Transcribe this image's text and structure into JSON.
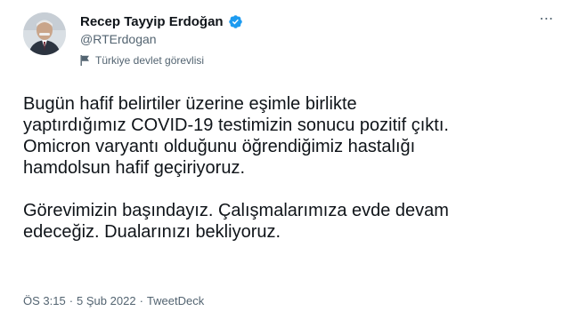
{
  "author": {
    "display_name": "Recep Tayyip Erdoğan",
    "handle": "@RTErdogan",
    "label": "Türkiye devlet görevlisi",
    "verified_color": "#1d9bf0"
  },
  "more_icon": "⋯",
  "tweet": {
    "paragraph1": [
      "Bugün hafif belirtiler üzerine eşimle birlikte",
      "yaptırdığımız COVID-19 testimizin sonucu pozitif çıktı.",
      "Omicron varyantı olduğunu öğrendiğimiz hastalığı",
      "hamdolsun hafif geçiriyoruz."
    ],
    "paragraph2": [
      "Görevimizin başındayız. Çalışmalarımıza evde devam",
      "edeceğiz. Dualarınızı bekliyoruz."
    ]
  },
  "meta": {
    "time": "ÖS 3:15",
    "sep1": "·",
    "date": "5 Şub 2022",
    "sep2": "·",
    "source": "TweetDeck"
  },
  "colors": {
    "text": "#0f1419",
    "secondary": "#536471",
    "verified": "#1d9bf0"
  }
}
